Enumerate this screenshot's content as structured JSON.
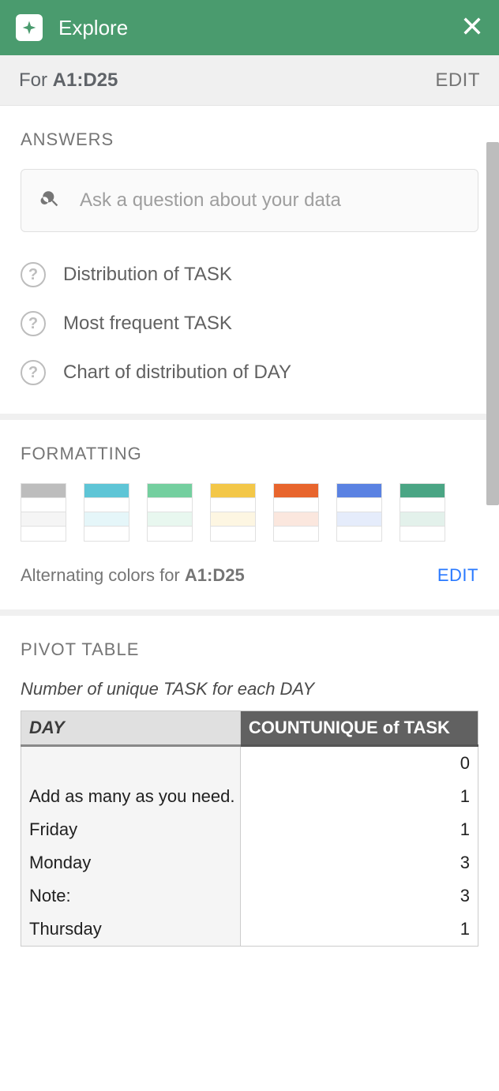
{
  "header": {
    "title": "Explore"
  },
  "range": {
    "prefix": "For",
    "value": "A1:D25",
    "edit": "EDIT"
  },
  "answers": {
    "title": "ANSWERS",
    "placeholder": "Ask a question about your data",
    "suggestions": [
      "Distribution of TASK",
      "Most frequent TASK",
      "Chart of distribution of DAY"
    ]
  },
  "formatting": {
    "title": "FORMATTING",
    "swatches": [
      {
        "c1": "#bdbdbd",
        "c2": "#ffffff",
        "c3": "#f5f5f5",
        "c4": "#ffffff"
      },
      {
        "c1": "#5ec5d6",
        "c2": "#ffffff",
        "c3": "#e5f6f9",
        "c4": "#ffffff"
      },
      {
        "c1": "#74cf9f",
        "c2": "#ffffff",
        "c3": "#e8f7ef",
        "c4": "#ffffff"
      },
      {
        "c1": "#f3c748",
        "c2": "#ffffff",
        "c3": "#fdf6e2",
        "c4": "#ffffff"
      },
      {
        "c1": "#e8652d",
        "c2": "#ffffff",
        "c3": "#fbe7de",
        "c4": "#ffffff"
      },
      {
        "c1": "#5a82e2",
        "c2": "#ffffff",
        "c3": "#e5ecfb",
        "c4": "#ffffff"
      },
      {
        "c1": "#4aa584",
        "c2": "#ffffff",
        "c3": "#e3f1eb",
        "c4": "#ffffff"
      }
    ],
    "label_prefix": "Alternating colors for",
    "label_range": "A1:D25",
    "edit": "EDIT"
  },
  "pivot": {
    "title": "PIVOT TABLE",
    "desc": "Number of unique TASK for each DAY",
    "col1": "DAY",
    "col2": "COUNTUNIQUE of TASK",
    "rows": [
      {
        "day": "",
        "count": "0"
      },
      {
        "day": "Add as many as you need.",
        "count": "1"
      },
      {
        "day": "Friday",
        "count": "1"
      },
      {
        "day": "Monday",
        "count": "3"
      },
      {
        "day": "Note:",
        "count": "3"
      },
      {
        "day": "Thursday",
        "count": "1"
      }
    ]
  }
}
